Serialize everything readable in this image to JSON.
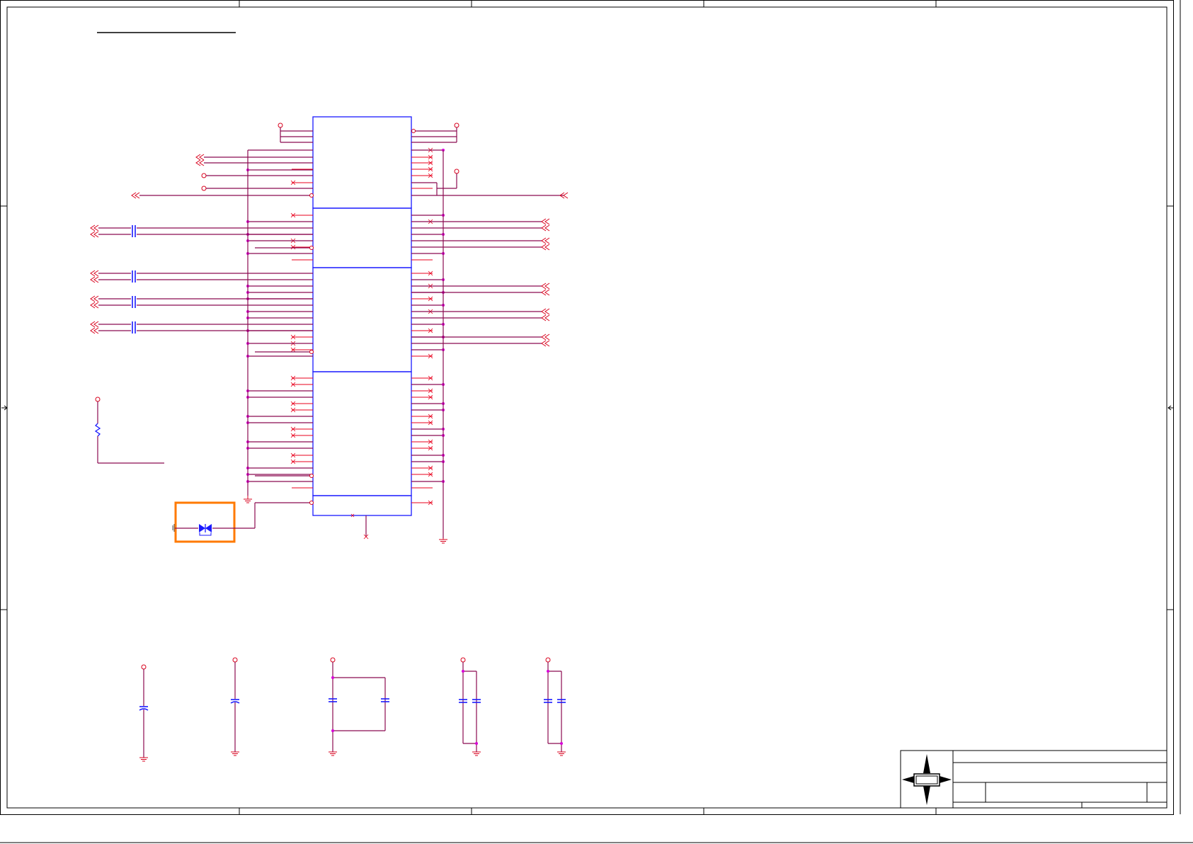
{
  "sheet": {
    "background": "#ffffff",
    "colors": {
      "wire": "#8b0a50",
      "pin": "#e8001c",
      "component_outline": "#1a1aff",
      "junction": "#d800d8",
      "highlight": "#ff7a00",
      "frame": "#000000"
    }
  },
  "icons": {
    "compass_logo": "compass-star-icon",
    "power_port": "power-port-icon",
    "ground": "ground-icon",
    "off_page_connector": "off-page-connector-icon",
    "capacitor": "capacitor-icon",
    "resistor": "resistor-icon",
    "diode": "tvs-diode-icon",
    "no_connect": "no-connect-icon"
  }
}
